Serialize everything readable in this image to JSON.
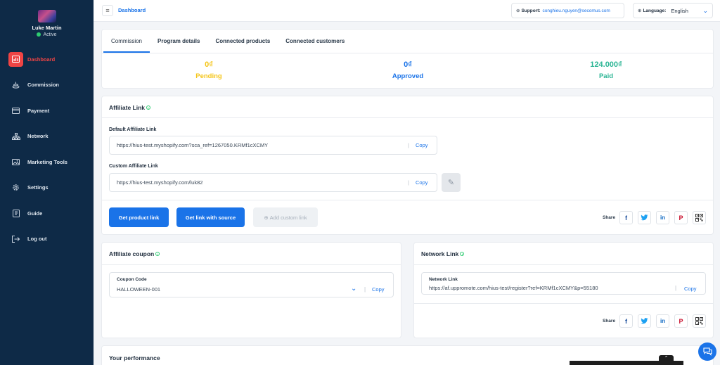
{
  "profile": {
    "name": "Luke Martin",
    "status": "Active"
  },
  "sidebar": {
    "items": [
      {
        "label": "Dashboard",
        "icon": "chart-icon"
      },
      {
        "label": "Commission",
        "icon": "coins-icon"
      },
      {
        "label": "Payment",
        "icon": "card-icon"
      },
      {
        "label": "Network",
        "icon": "network-icon"
      },
      {
        "label": "Marketing Tools",
        "icon": "image-icon"
      },
      {
        "label": "Settings",
        "icon": "gear-icon"
      },
      {
        "label": "Guide",
        "icon": "book-icon"
      },
      {
        "label": "Log out",
        "icon": "logout-icon"
      }
    ]
  },
  "topbar": {
    "breadcrumb": "Dashboard",
    "support_label": "Support:",
    "support_email": "conghieu.nguyen@secomus.com",
    "language_label": "Language:",
    "language_value": "English"
  },
  "tabs": [
    "Commission",
    "Program details",
    "Connected products",
    "Connected customers"
  ],
  "stats": {
    "pending": {
      "value": "0₫",
      "label": "Pending"
    },
    "approved": {
      "value": "0₫",
      "label": "Approved"
    },
    "paid": {
      "value": "124.000₫",
      "label": "Paid"
    }
  },
  "affiliate_link": {
    "title": "Affiliate Link",
    "default_label": "Default Affiliate Link",
    "default_url": "https://hius-test.myshopify.com?sca_ref=1267050.KRMf1cXCMY",
    "custom_label": "Custom Affiliate Link",
    "custom_url": "https://hius-test.myshopify.com/luk82",
    "copy_label": "Copy",
    "sep": "|",
    "btn_product": "Get product link",
    "btn_source": "Get link with source",
    "btn_custom": "Add custom link",
    "share_label": "Share"
  },
  "coupon": {
    "title": "Affiliate coupon",
    "field_label": "Coupon Code",
    "value": "HALLOWEEN-001",
    "copy_label": "Copy"
  },
  "network": {
    "title": "Network Link",
    "field_label": "Network Link",
    "value": "https://af.uppromote.com/hius-test/register?ref=KRMf1cXCMY&p=55180",
    "copy_label": "Copy",
    "share_label": "Share"
  },
  "performance": {
    "title": "Your performance"
  },
  "colors": {
    "sidebar": "#0e2a47",
    "accent": "#1a73e8",
    "active_nav": "#ef4444",
    "pending": "#f5c518",
    "approved": "#1a73e8",
    "paid": "#2bb594"
  }
}
